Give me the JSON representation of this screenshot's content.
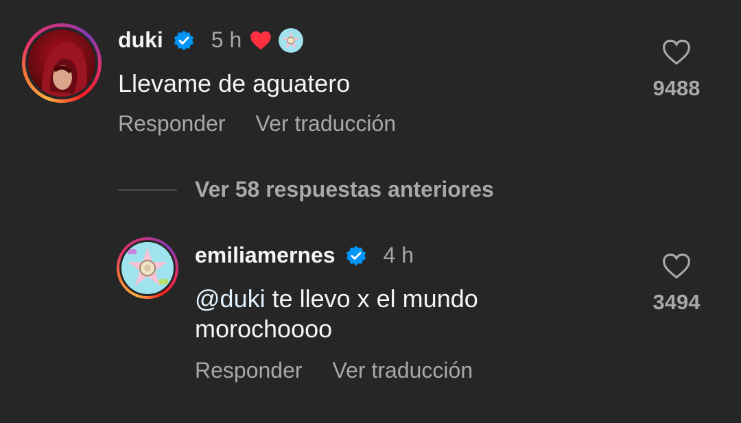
{
  "comments": [
    {
      "username": "duki",
      "verified": true,
      "time": "5 h",
      "liked_by_creator": true,
      "text": "Llevame de aguatero",
      "reply_label": "Responder",
      "translate_label": "Ver traducción",
      "like_count": "9488"
    }
  ],
  "view_replies": "Ver 58 respuestas anteriores",
  "reply": {
    "username": "emiliamernes",
    "verified": true,
    "time": "4 h",
    "mention": "@duki",
    "text_rest": " te llevo x el mundo morochoooo",
    "reply_label": "Responder",
    "translate_label": "Ver traducción",
    "like_count": "3494"
  },
  "colors": {
    "background": "#262626",
    "verified_blue": "#0095f6",
    "heart_red": "#ff3040",
    "secondary_text": "#a8a8a8"
  }
}
